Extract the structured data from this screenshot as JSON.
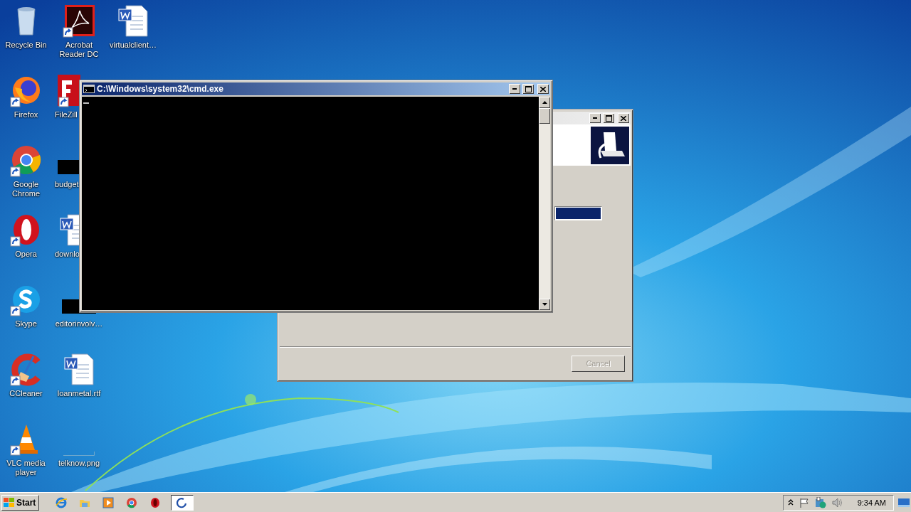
{
  "desktop_icons": [
    {
      "label": "Recycle Bin",
      "kind": "recycle",
      "shortcut": false,
      "covered": false
    },
    {
      "label": "Firefox",
      "kind": "firefox",
      "shortcut": true,
      "covered": false
    },
    {
      "label": "Google Chrome",
      "kind": "chrome",
      "shortcut": true,
      "covered": false
    },
    {
      "label": "Opera",
      "kind": "opera",
      "shortcut": true,
      "covered": false
    },
    {
      "label": "Skype",
      "kind": "skype",
      "shortcut": true,
      "covered": false
    },
    {
      "label": "CCleaner",
      "kind": "ccleaner",
      "shortcut": true,
      "covered": false
    },
    {
      "label": "VLC media player",
      "kind": "vlc",
      "shortcut": true,
      "covered": false
    },
    {
      "label": "Acrobat Reader DC",
      "kind": "pdf",
      "shortcut": true,
      "covered": false
    },
    {
      "label": "FileZill",
      "kind": "filezilla",
      "shortcut": true,
      "covered": true
    },
    {
      "label": "budget",
      "kind": "dark",
      "shortcut": false,
      "covered": true
    },
    {
      "label": "downlo",
      "kind": "word",
      "shortcut": false,
      "covered": true
    },
    {
      "label": "editorinvolv…",
      "kind": "dark",
      "shortcut": false,
      "covered": false
    },
    {
      "label": "loanmetal.rtf",
      "kind": "word",
      "shortcut": false,
      "covered": false
    },
    {
      "label": "telknow.png",
      "kind": "blank",
      "shortcut": false,
      "covered": false
    },
    {
      "label": "virtualclient…",
      "kind": "word",
      "shortcut": false,
      "covered": false
    }
  ],
  "setup_dialog": {
    "progress": {
      "level": 1
    },
    "cancel_button": {
      "label": "Cancel",
      "disabled": true
    }
  },
  "cmd_window": {
    "title": "C:\\Windows\\system32\\cmd.exe"
  },
  "taskbar": {
    "start": "Start",
    "quick_launch": [
      {
        "kind": "ie"
      },
      {
        "kind": "folder"
      },
      {
        "kind": "media"
      },
      {
        "kind": "chrome"
      },
      {
        "kind": "opera"
      }
    ],
    "tasks": [
      {
        "kind": "setup",
        "selected": true
      }
    ],
    "tray": {
      "clock": "9:34 AM"
    }
  }
}
